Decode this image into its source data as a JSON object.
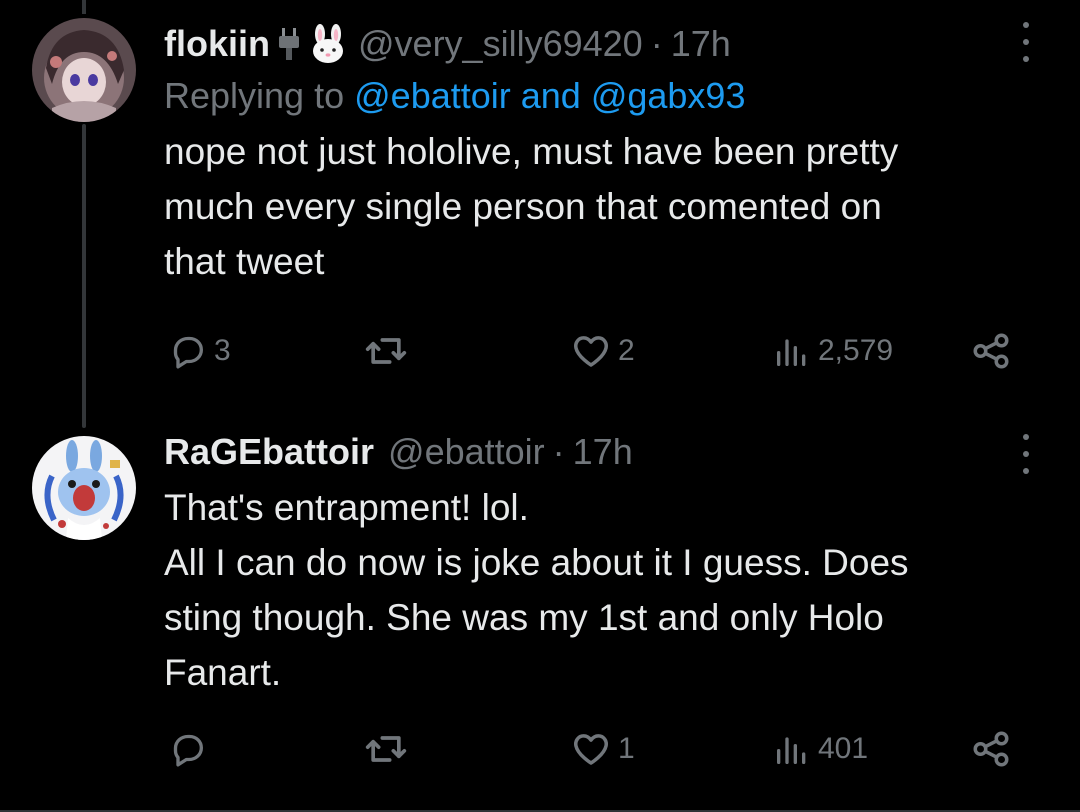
{
  "tweets": [
    {
      "display_name": "flokiin",
      "badges": [
        "plug-icon",
        "rabbit-face-icon"
      ],
      "handle": "@very_silly69420",
      "separator": "·",
      "time": "17h",
      "reply_prefix": "Replying to",
      "reply_mentions": "@ebattoir and @gabx93",
      "text": [
        "nope not just hololive, must have been pretty",
        "much every single person that comented on",
        "that tweet"
      ],
      "stats": {
        "replies": "3",
        "retweets": "",
        "likes": "2",
        "views": "2,579"
      }
    },
    {
      "display_name": "RaGEbattoir",
      "handle": "@ebattoir",
      "separator": "·",
      "time": "17h",
      "text": [
        "That's entrapment! lol.",
        "All I can do now is joke about it I guess. Does",
        "sting though. She was my 1st and only Holo",
        "Fanart."
      ],
      "stats": {
        "replies": "",
        "retweets": "",
        "likes": "1",
        "views": "401"
      }
    }
  ],
  "colors": {
    "background": "#000000",
    "text": "#e7e9ea",
    "muted": "#71767b",
    "link": "#1d9bf0",
    "thread_line": "#333639"
  }
}
